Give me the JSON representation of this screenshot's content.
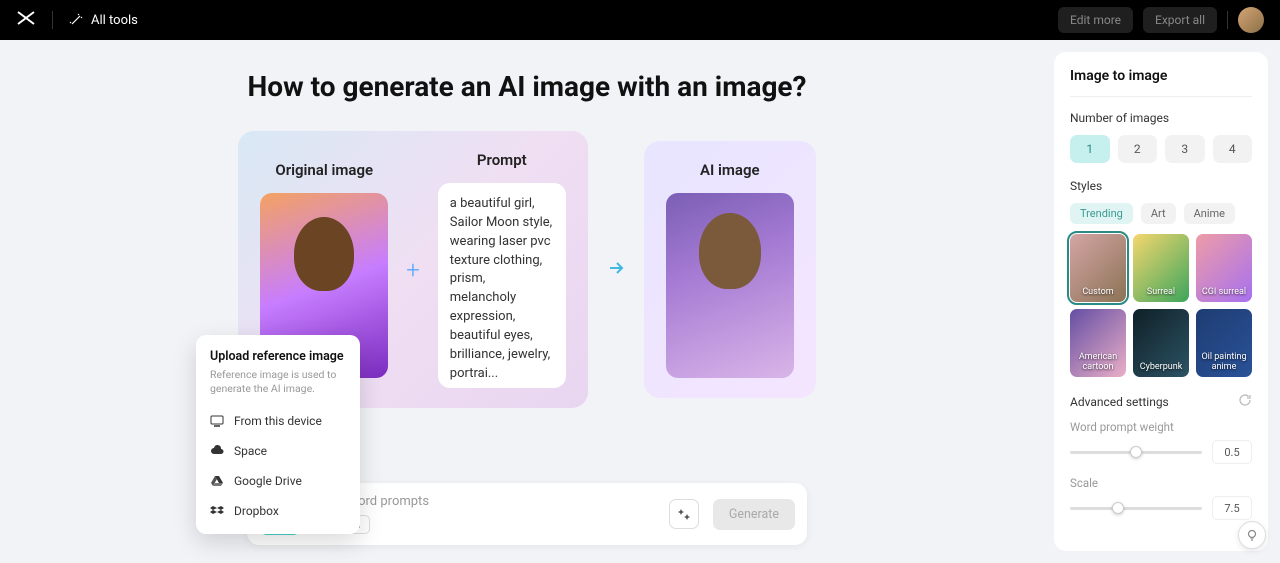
{
  "header": {
    "allTools": "All tools",
    "editMore": "Edit more",
    "exportAll": "Export all"
  },
  "page": {
    "title": "How to generate an AI image with an image?"
  },
  "cards": {
    "originalTitle": "Original image",
    "promptTitle": "Prompt",
    "promptText": "a beautiful girl, Sailor Moon style, wearing laser pvc texture clothing, prism, melancholy expression, beautiful eyes, brilliance, jewelry, portrai...",
    "aiTitle": "AI image"
  },
  "upload": {
    "title": "Upload reference image",
    "subtitle": "Reference image is used to generate the AI image.",
    "items": [
      {
        "label": "From this device",
        "icon": "device"
      },
      {
        "label": "Space",
        "icon": "cloud"
      },
      {
        "label": "Google Drive",
        "icon": "gdrive"
      },
      {
        "label": "Dropbox",
        "icon": "dropbox"
      }
    ]
  },
  "inputBar": {
    "placeholder": "Enter word prompts",
    "chip": "Custom",
    "generate": "Generate"
  },
  "sidebar": {
    "title": "Image to image",
    "numImagesLabel": "Number of images",
    "numOptions": [
      "1",
      "2",
      "3",
      "4"
    ],
    "numSelected": "1",
    "stylesLabel": "Styles",
    "styleTabs": [
      "Trending",
      "Art",
      "Anime"
    ],
    "styleTabSelected": "Trending",
    "styles": [
      "Custom",
      "Surreal",
      "CGI surreal",
      "American cartoon",
      "Cyberpunk",
      "Oil painting anime"
    ],
    "styleSelected": "Custom",
    "advancedLabel": "Advanced settings",
    "wordWeightLabel": "Word prompt weight",
    "wordWeightValue": "0.5",
    "wordWeightPct": 50,
    "scaleLabel": "Scale",
    "scaleValue": "7.5",
    "scalePct": 36
  }
}
